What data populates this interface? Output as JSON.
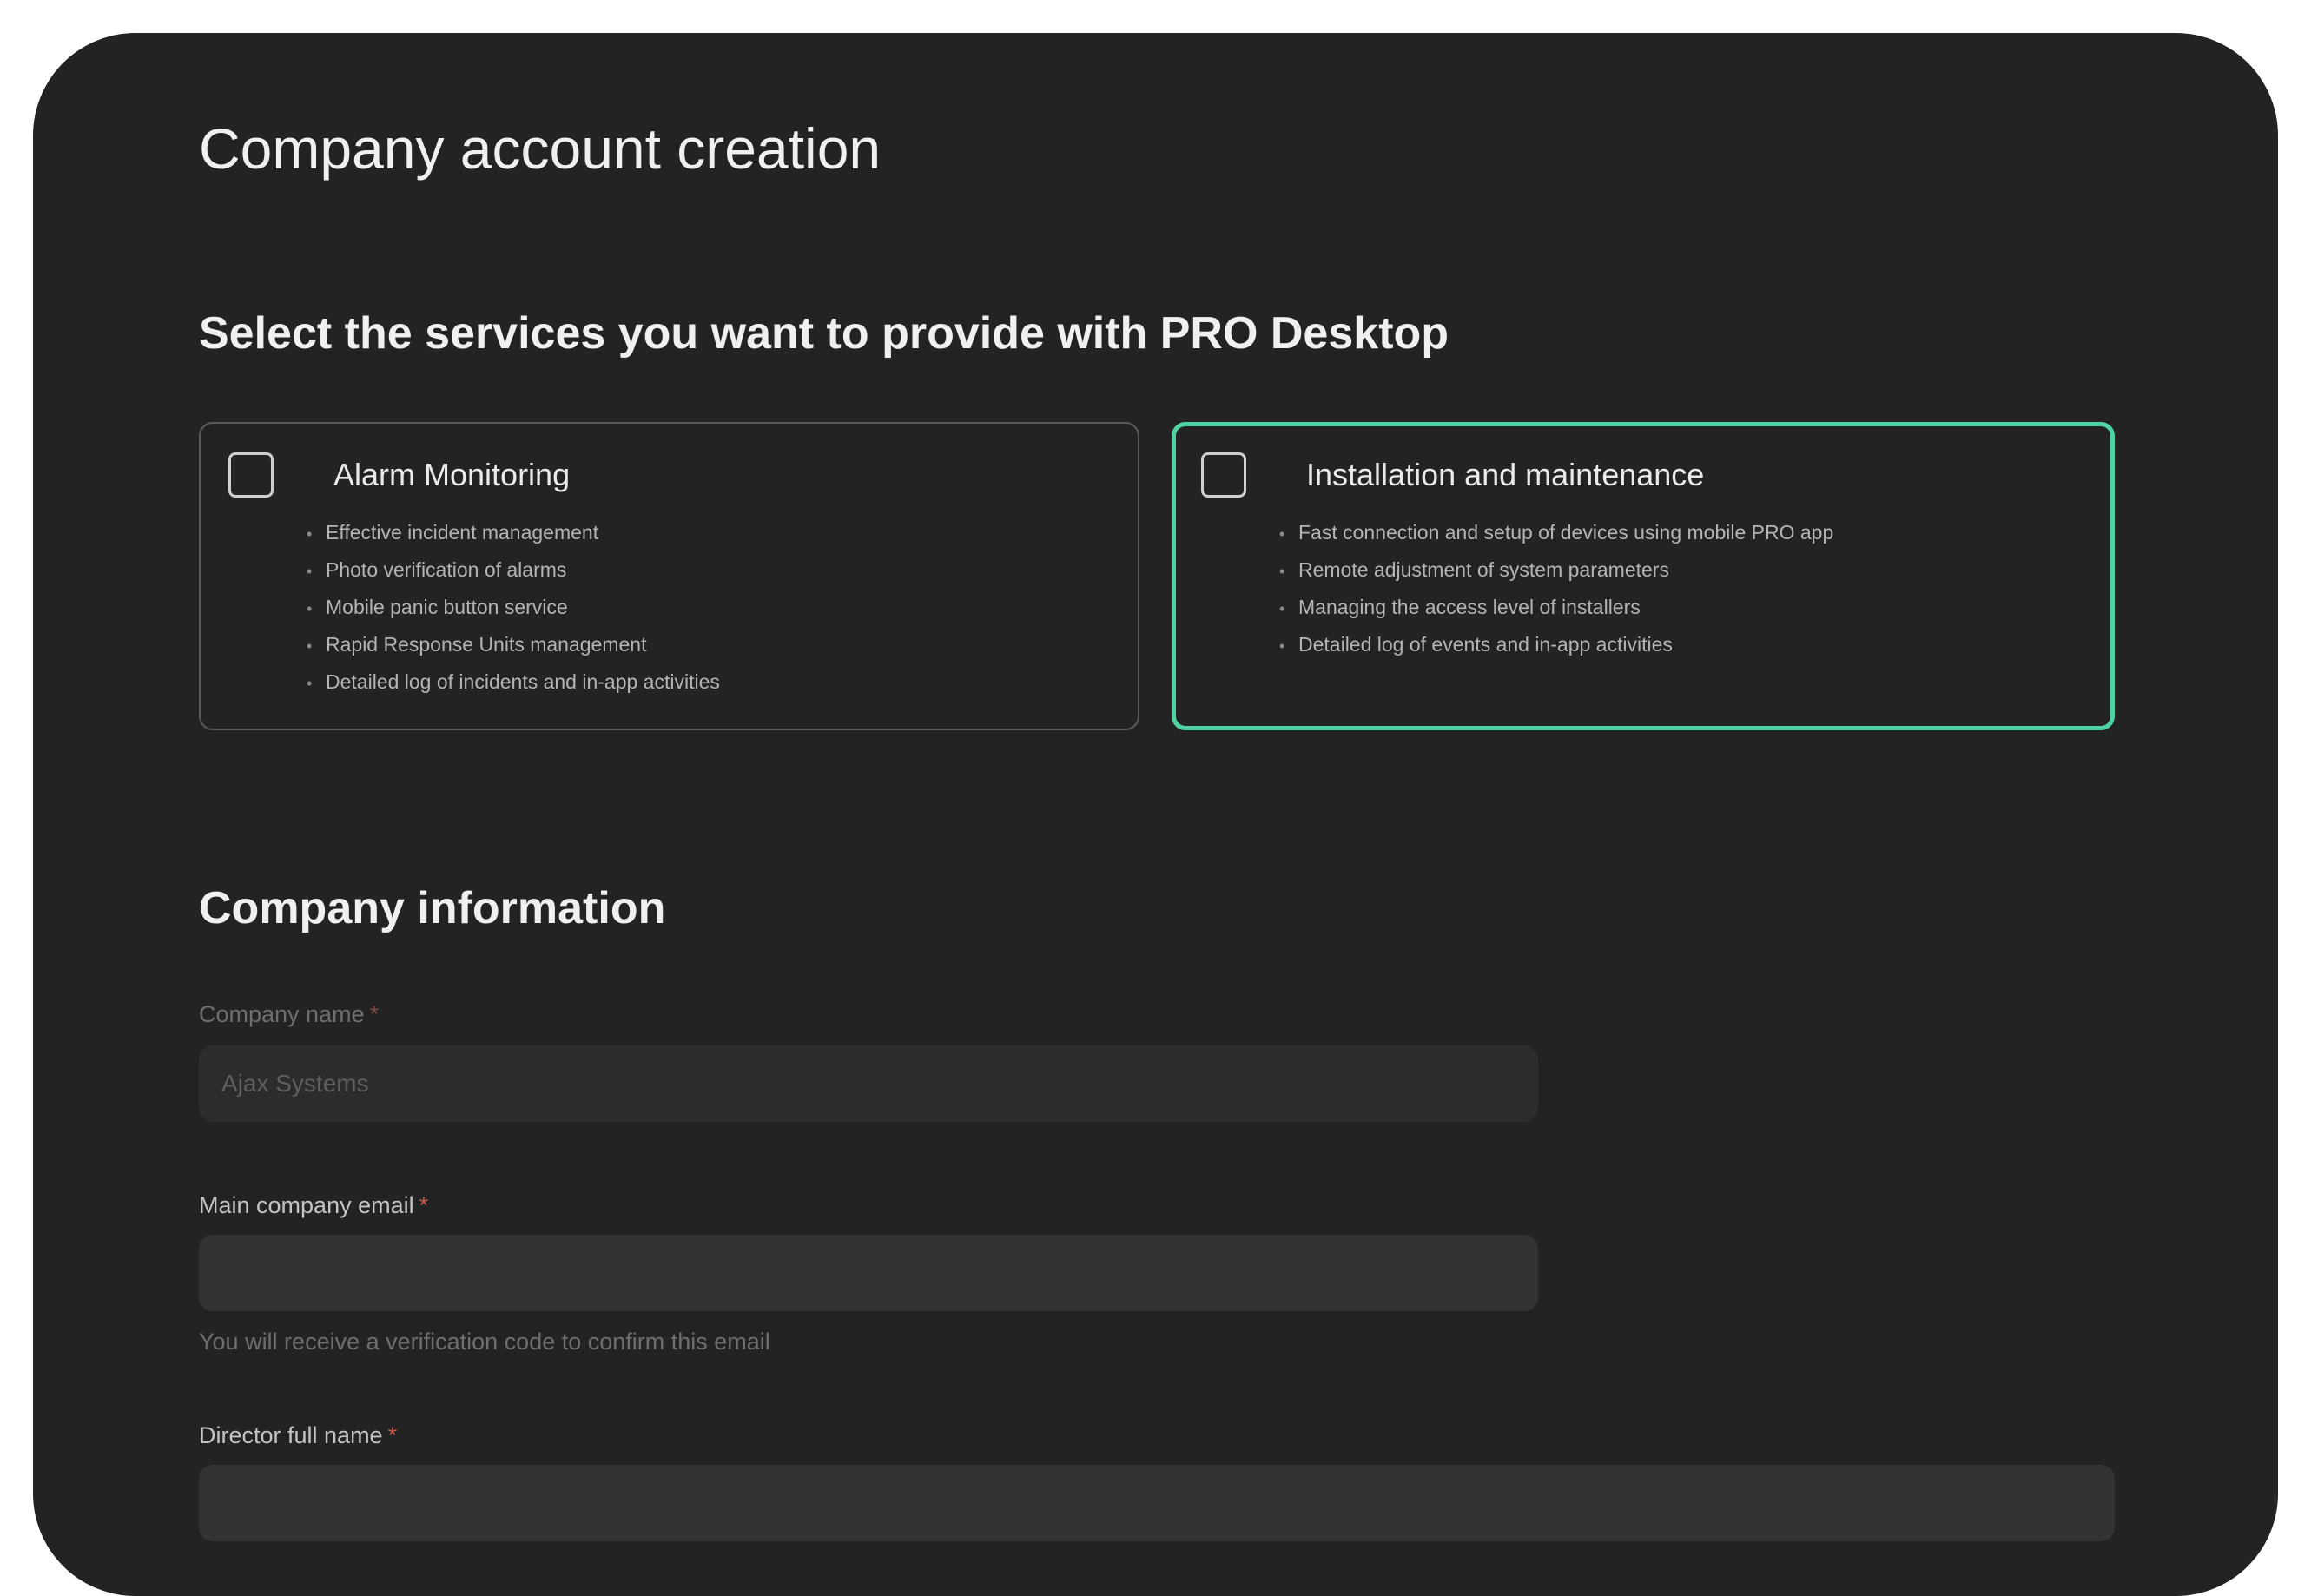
{
  "page": {
    "title": "Company account creation"
  },
  "services": {
    "heading": "Select the services you want to provide with PRO Desktop",
    "options": [
      {
        "title": "Alarm Monitoring",
        "checked": false,
        "features": [
          "Effective incident management",
          "Photo verification of alarms",
          "Mobile panic button service",
          "Rapid Response Units management",
          "Detailed log of incidents and in-app activities"
        ]
      },
      {
        "title": "Installation and maintenance",
        "checked": false,
        "focused": true,
        "focus_color": "#4fd3a2",
        "features": [
          "Fast connection and setup of devices using mobile PRO app",
          "Remote adjustment of system parameters",
          "Managing the access level of installers",
          "Detailed log of events and in-app activities"
        ]
      }
    ]
  },
  "company": {
    "heading": "Company information",
    "required_marker": "*",
    "name_field": {
      "label": "Company name",
      "placeholder": "Ajax Systems",
      "value": "",
      "disabled": true
    },
    "email_field": {
      "label": "Main company email",
      "placeholder": "",
      "value": "",
      "hint": "You will receive a verification code to confirm this email"
    },
    "director_field": {
      "label": "Director full name",
      "placeholder": "",
      "value": ""
    }
  },
  "colors": {
    "background": "#232323",
    "accent": "#4fd3a2",
    "required": "#c7584b",
    "input_bg": "#333333"
  }
}
